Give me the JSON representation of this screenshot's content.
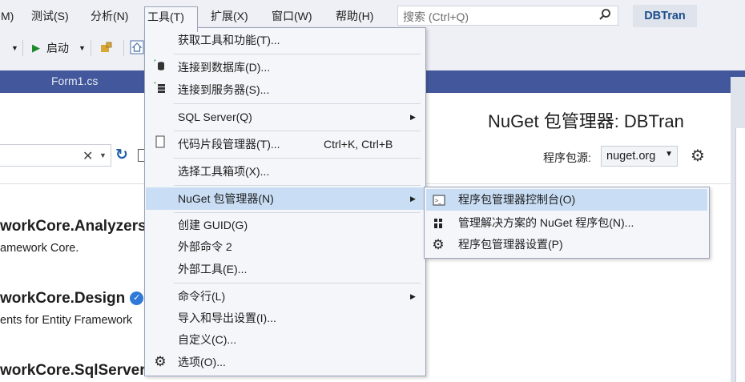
{
  "menubar": {
    "items": [
      "M)",
      "测试(S)",
      "分析(N)",
      "工具(T)",
      "扩展(X)",
      "窗口(W)",
      "帮助(H)"
    ],
    "search_placeholder": "搜索 (Ctrl+Q)",
    "solution_name": "DBTran"
  },
  "toolbar": {
    "start_label": "启动"
  },
  "tabs": {
    "active_doc": "Form1.cs"
  },
  "nuget_panel": {
    "title": "NuGet 包管理器: DBTran",
    "source_label": "程序包源:",
    "source_value": "nuget.org",
    "packages": [
      {
        "name": "workCore.Analyzers",
        "desc": "amework Core.",
        "verified": false
      },
      {
        "name": "workCore.Design",
        "desc": "ents for Entity Framework",
        "verified": true
      },
      {
        "name": "workCore.SqlServer",
        "desc": "",
        "verified": false
      }
    ]
  },
  "tools_menu": {
    "items": [
      {
        "label": "获取工具和功能(T)...",
        "icon": "",
        "shortcut": "",
        "submenu": false
      },
      {
        "label": "连接到数据库(D)...",
        "icon": "database-connect-icon",
        "shortcut": "",
        "submenu": false
      },
      {
        "label": "连接到服务器(S)...",
        "icon": "server-connect-icon",
        "shortcut": "",
        "submenu": false
      },
      {
        "label": "SQL Server(Q)",
        "icon": "",
        "shortcut": "",
        "submenu": true
      },
      {
        "label": "代码片段管理器(T)...",
        "icon": "snippet-icon",
        "shortcut": "Ctrl+K, Ctrl+B",
        "submenu": false
      },
      {
        "label": "选择工具箱项(X)...",
        "icon": "",
        "shortcut": "",
        "submenu": false
      },
      {
        "label": "NuGet 包管理器(N)",
        "icon": "",
        "shortcut": "",
        "submenu": true
      },
      {
        "label": "创建 GUID(G)",
        "icon": "",
        "shortcut": "",
        "submenu": false
      },
      {
        "label": "外部命令 2",
        "icon": "",
        "shortcut": "",
        "submenu": false
      },
      {
        "label": "外部工具(E)...",
        "icon": "",
        "shortcut": "",
        "submenu": false
      },
      {
        "label": "命令行(L)",
        "icon": "",
        "shortcut": "",
        "submenu": true
      },
      {
        "label": "导入和导出设置(I)...",
        "icon": "",
        "shortcut": "",
        "submenu": false
      },
      {
        "label": "自定义(C)...",
        "icon": "",
        "shortcut": "",
        "submenu": false
      },
      {
        "label": "选项(O)...",
        "icon": "gear-icon",
        "shortcut": "",
        "submenu": false
      }
    ]
  },
  "nuget_submenu": {
    "items": [
      {
        "label": "程序包管理器控制台(O)",
        "icon": "console-icon"
      },
      {
        "label": "管理解决方案的 NuGet 程序包(N)...",
        "icon": "packages-icon"
      },
      {
        "label": "程序包管理器设置(P)",
        "icon": "gear-icon"
      }
    ]
  },
  "colors": {
    "accent_tabstrip": "#43589c",
    "menu_highlight": "#c9def5",
    "verified_badge": "#2f7ad9"
  }
}
